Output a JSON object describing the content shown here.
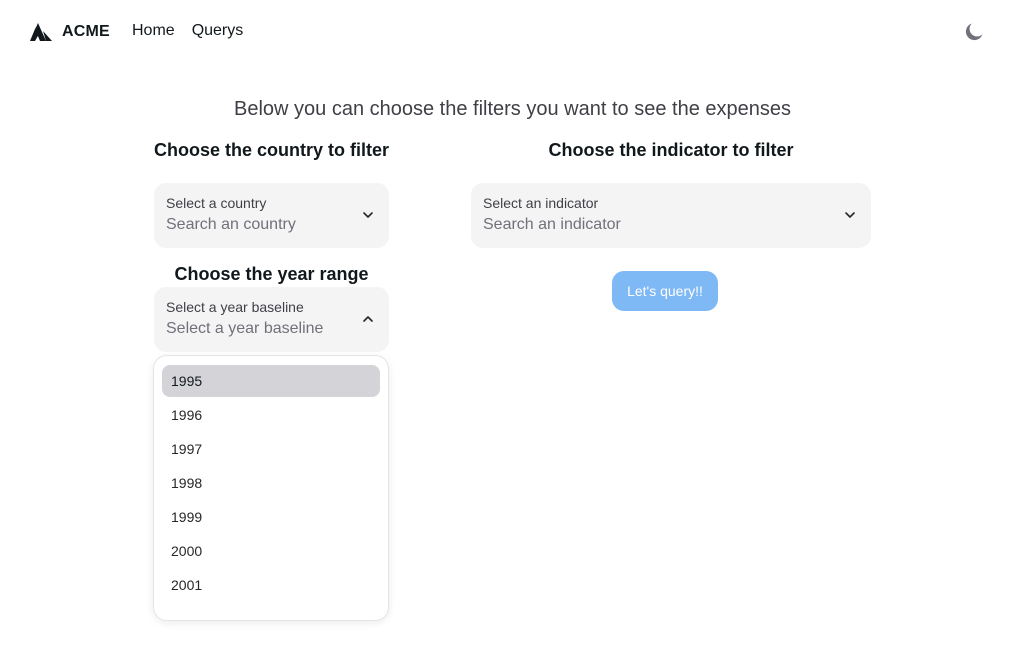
{
  "nav": {
    "brand": "ACME",
    "links": [
      "Home",
      "Querys"
    ],
    "theme_icon": "moon-icon"
  },
  "intro": "Below you can choose the filters you want to see the expenses",
  "country": {
    "title": "Choose the country to filter",
    "label": "Select a country",
    "placeholder": "Search an country"
  },
  "indicator": {
    "title": "Choose the indicator to filter",
    "label": "Select an indicator",
    "placeholder": "Search an indicator"
  },
  "year": {
    "title": "Choose the year range",
    "label": "Select a year baseline",
    "placeholder": "Select a year baseline",
    "options": [
      "1995",
      "1996",
      "1997",
      "1998",
      "1999",
      "2000",
      "2001"
    ],
    "highlighted": "1995"
  },
  "query_button": "Let's query!!",
  "colors": {
    "accent_button": "#7eb8f5",
    "field_bg": "#f4f4f5",
    "option_highlight": "#d4d4d8"
  }
}
